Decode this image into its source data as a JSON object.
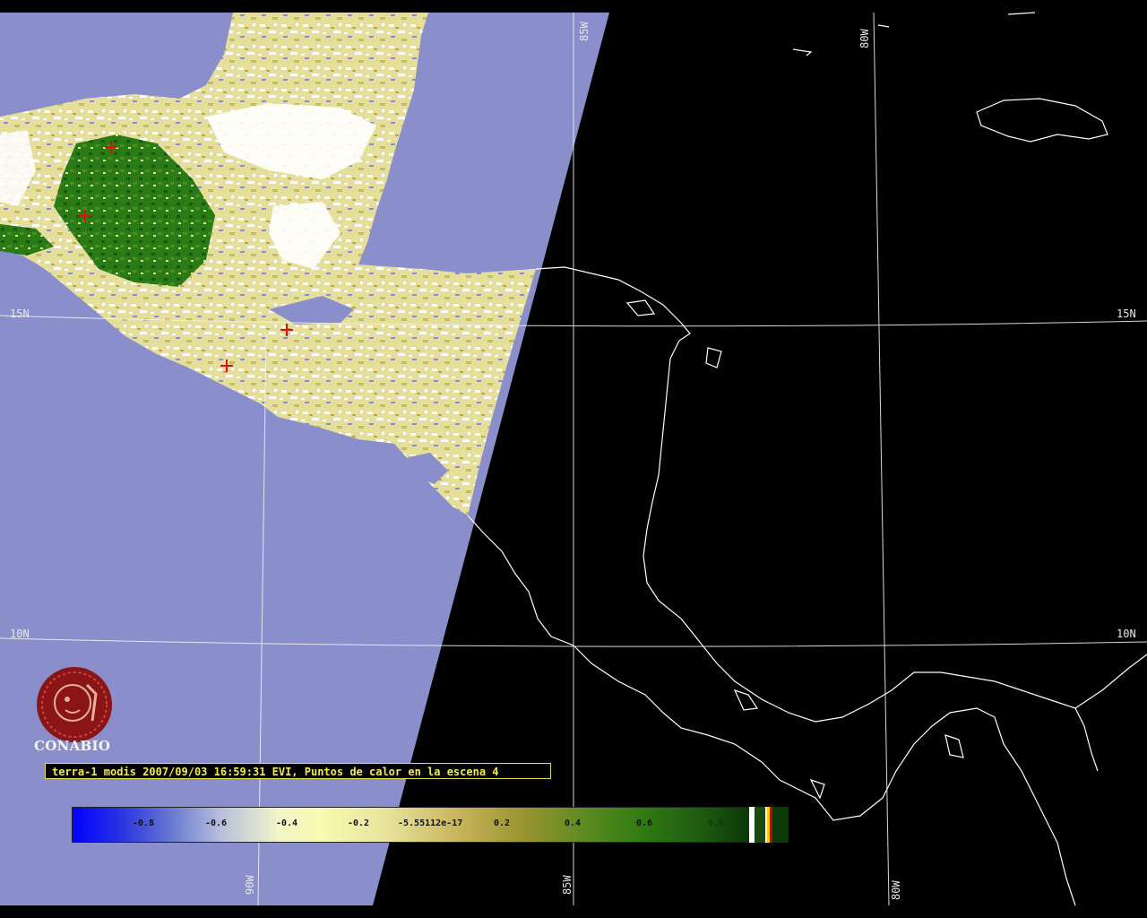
{
  "title": "terra-1 modis 2007/09/03 16:59:31 EVI, Puntos de calor en la escena 4",
  "logo": {
    "name": "CONABIO"
  },
  "latitude_labels": {
    "lat15_left": "15N",
    "lat15_right": "15N",
    "lat10_left": "10N",
    "lat10_right": "10N"
  },
  "longitude_labels": {
    "lon85_top": "85W",
    "lon80_top": "80W",
    "lon90_bottom": "90W",
    "lon85_bottom": "85W",
    "lon80_bottom": "80W"
  },
  "colorbar": {
    "ticks": [
      "-0.8",
      "-0.6",
      "-0.4",
      "-0.2",
      "-5.55112e-17",
      "0.2",
      "0.4",
      "0.6",
      "0.8"
    ],
    "extra_swatches": [
      "#ffffff",
      "#1a4a10",
      "#ffffff",
      "#ffcc00",
      "#cc0000",
      "#0b3a08"
    ]
  },
  "colors": {
    "water": "#8a8fcc",
    "no_data": "#000000",
    "vegetation_low": "#e9e29a",
    "vegetation_high": "#1f6e12",
    "coastline": "#ffffff",
    "graticule": "#f0f0f0",
    "hotspot": "#e01010",
    "caption": "#f2ec4a",
    "logo": "#8b1414"
  },
  "hotspots_count": 4
}
